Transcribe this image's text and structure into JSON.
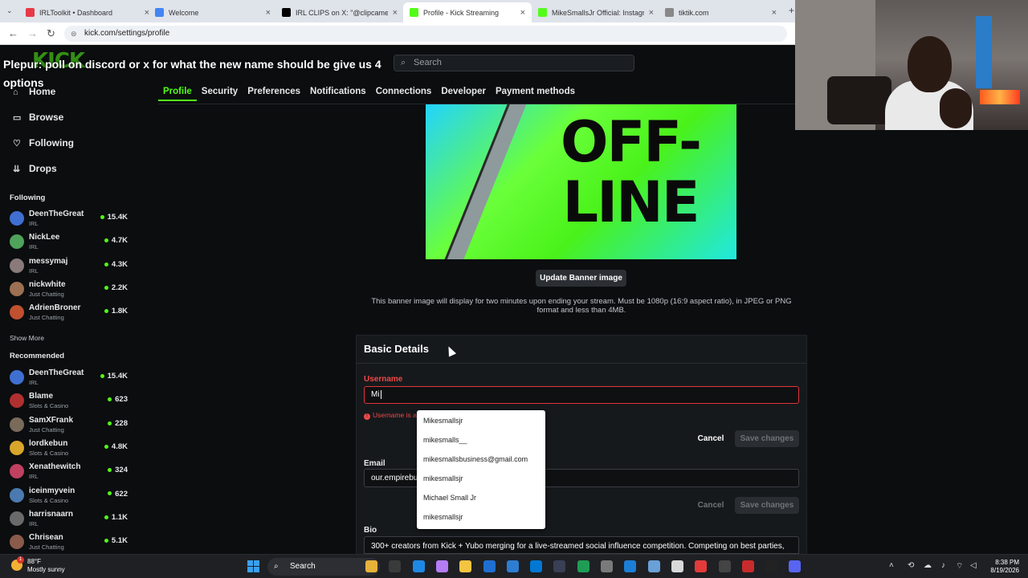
{
  "browser": {
    "tabs": [
      {
        "title": "IRLToolkit • Dashboard",
        "icon": "irltoolkit-icon",
        "color": "#e63946"
      },
      {
        "title": "Welcome",
        "icon": "google-icon",
        "color": "#4285f4"
      },
      {
        "title": "IRL CLIPS on X: \"@clipcamel Th",
        "icon": "x-icon",
        "color": "#000000"
      },
      {
        "title": "Profile - Kick Streaming",
        "icon": "kick-icon",
        "color": "#53fc18",
        "active": true
      },
      {
        "title": "MikeSmallsJr Official: Instagran",
        "icon": "kick-icon",
        "color": "#53fc18"
      },
      {
        "title": "tiktik.com",
        "icon": "globe-icon",
        "color": "#888888"
      }
    ],
    "url": "kick.com/settings/profile"
  },
  "overlay": {
    "line1": "Plepur: poll on discord or x for what the new name should be give us 4",
    "line2": "options"
  },
  "header": {
    "logo": "KICK",
    "search_placeholder": "Search"
  },
  "settings_tabs": [
    "Profile",
    "Security",
    "Preferences",
    "Notifications",
    "Connections",
    "Developer",
    "Payment methods"
  ],
  "sidebar": {
    "nav": [
      {
        "label": "Home",
        "icon": "home-icon",
        "glyph": "⌂"
      },
      {
        "label": "Browse",
        "icon": "browse-icon",
        "glyph": "▭"
      },
      {
        "label": "Following",
        "icon": "heart-icon",
        "glyph": "♡"
      },
      {
        "label": "Drops",
        "icon": "drops-icon",
        "glyph": "⇊"
      }
    ],
    "following_heading": "Following",
    "following": [
      {
        "name": "DeenTheGreat",
        "category": "IRL",
        "viewers": "15.4K",
        "color": "#3f6fd1"
      },
      {
        "name": "NickLee",
        "category": "IRL",
        "viewers": "4.7K",
        "color": "#4fa35a"
      },
      {
        "name": "messymaj",
        "category": "IRL",
        "viewers": "4.3K",
        "color": "#8a7a7a"
      },
      {
        "name": "nickwhite",
        "category": "Just Chatting",
        "viewers": "2.2K",
        "color": "#9c7052"
      },
      {
        "name": "AdrienBroner",
        "category": "Just Chatting",
        "viewers": "1.8K",
        "color": "#c05030"
      }
    ],
    "show_more": "Show More",
    "recommended_heading": "Recommended",
    "recommended": [
      {
        "name": "DeenTheGreat",
        "category": "IRL",
        "viewers": "15.4K",
        "color": "#3f6fd1"
      },
      {
        "name": "Blame",
        "category": "Slots & Casino",
        "viewers": "623",
        "color": "#b03030"
      },
      {
        "name": "SamXFrank",
        "category": "Just Chatting",
        "viewers": "228",
        "color": "#7a6a5a"
      },
      {
        "name": "lordkebun",
        "category": "Slots & Casino",
        "viewers": "4.8K",
        "color": "#d8a62a"
      },
      {
        "name": "Xenathewitch",
        "category": "IRL",
        "viewers": "324",
        "color": "#c04060"
      },
      {
        "name": "iceinmyvein",
        "category": "Slots & Casino",
        "viewers": "622",
        "color": "#4a7ab0"
      },
      {
        "name": "harrisnaarn",
        "category": "IRL",
        "viewers": "1.1K",
        "color": "#6a6a6a"
      },
      {
        "name": "Chrisean",
        "category": "Just Chatting",
        "viewers": "5.1K",
        "color": "#8a5a4a"
      }
    ]
  },
  "banner": {
    "text": "OFF- LINE",
    "update_button": "Update Banner image",
    "note": "This banner image will display for two minutes upon ending your stream. Must be 1080p (16:9 aspect ratio), in JPEG or PNG format and less than 4MB."
  },
  "basic_details": {
    "title": "Basic Details",
    "username_label": "Username",
    "username_value": "Mi",
    "username_error": "Username is a",
    "cancel": "Cancel",
    "save": "Save changes",
    "email_label": "Email",
    "email_value": "our.empirebu",
    "bio_label": "Bio",
    "bio_value": "300+ creators from Kick + Yubo merging for a live-streamed social influence competition. Competing on best parties,"
  },
  "autocomplete": [
    "Mikesmallsjr",
    "mikesmalls__",
    "mikesmallsbusiness@gmail.com",
    "mikesmallsjr",
    "Michael Small Jr",
    "mikesmallsjr"
  ],
  "taskbar": {
    "temp": "88°F",
    "weather": "Mostly sunny",
    "badge": "1",
    "search": "Search",
    "time": "8:38 PM",
    "date": "8/19/2026"
  }
}
